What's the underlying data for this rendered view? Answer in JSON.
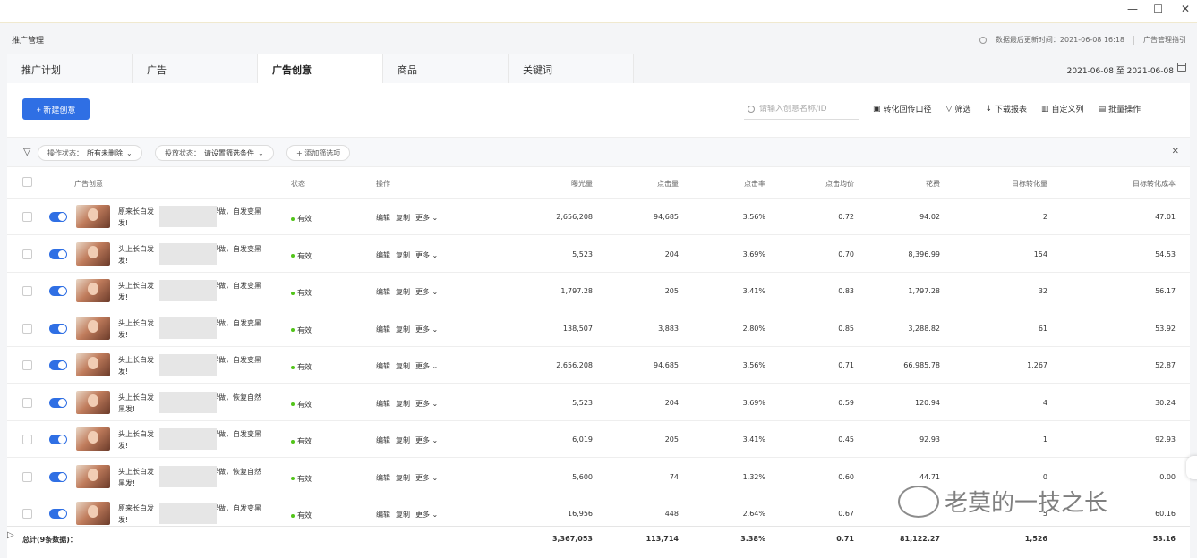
{
  "window": {
    "minimize": "—",
    "maximize": "☐",
    "close": "✕"
  },
  "header": {
    "title": "推广管理",
    "update_label": "数据最后更新时间：2021-06-08 16:18",
    "guide": "广告管理指引"
  },
  "tabs": [
    {
      "label": "推广计划",
      "active": false
    },
    {
      "label": "广告",
      "active": false
    },
    {
      "label": "广告创意",
      "active": true
    },
    {
      "label": "商品",
      "active": false
    },
    {
      "label": "关键词",
      "active": false
    }
  ],
  "date_range": "2021-06-08 至 2021-06-08",
  "toolbar": {
    "new_button": "+ 新建创意",
    "search_placeholder": "请输入创意名称/ID",
    "conversion": "转化回传口径",
    "filter": "筛选",
    "download": "下载报表",
    "custom_columns": "自定义列",
    "batch": "批量操作"
  },
  "filters": {
    "op_status_label": "操作状态：",
    "op_status_value": "所有未删除",
    "delivery_label": "投放状态：",
    "delivery_value": "请设置筛选条件",
    "add_filter": "+ 添加筛选项"
  },
  "columns": {
    "creative": "广告创意",
    "status": "状态",
    "ops": "操作",
    "impressions": "曝光量",
    "clicks": "点击量",
    "ctr": "点击率",
    "cpc": "点击均价",
    "cost": "花费",
    "conversions": "目标转化量",
    "cpa": "目标转化成本"
  },
  "op_labels": {
    "edit": "编辑",
    "copy": "复制",
    "more": "更多"
  },
  "rows": [
    {
      "line1": "原来长白发",
      "line1_tail": "这样做，自发变黑",
      "line2": "发!",
      "status": "有效",
      "impressions": "2,656,208",
      "clicks": "94,685",
      "ctr": "3.56%",
      "cpc": "0.72",
      "cost": "94.02",
      "conversions": "2",
      "cpa": "47.01"
    },
    {
      "line1": "头上长白发",
      "line1_tail": "这样做，自发变黑",
      "line2": "发!",
      "status": "有效",
      "impressions": "5,523",
      "clicks": "204",
      "ctr": "3.69%",
      "cpc": "0.70",
      "cost": "8,396.99",
      "conversions": "154",
      "cpa": "54.53"
    },
    {
      "line1": "头上长白发",
      "line1_tail": "这样做，自发变黑",
      "line2": "发!",
      "status": "有效",
      "impressions": "1,797.28",
      "clicks": "205",
      "ctr": "3.41%",
      "cpc": "0.83",
      "cost": "1,797.28",
      "conversions": "32",
      "cpa": "56.17"
    },
    {
      "line1": "头上长白发",
      "line1_tail": "这样做，自发变黑",
      "line2": "发!",
      "status": "有效",
      "impressions": "138,507",
      "clicks": "3,883",
      "ctr": "2.80%",
      "cpc": "0.85",
      "cost": "3,288.82",
      "conversions": "61",
      "cpa": "53.92"
    },
    {
      "line1": "头上长白发",
      "line1_tail": "这样做，自发变黑",
      "line2": "发!",
      "status": "有效",
      "impressions": "2,656,208",
      "clicks": "94,685",
      "ctr": "3.56%",
      "cpc": "0.71",
      "cost": "66,985.78",
      "conversions": "1,267",
      "cpa": "52.87"
    },
    {
      "line1": "头上长白发",
      "line1_tail": "这样做，恢复自然",
      "line2": "黑发!",
      "status": "有效",
      "impressions": "5,523",
      "clicks": "204",
      "ctr": "3.69%",
      "cpc": "0.59",
      "cost": "120.94",
      "conversions": "4",
      "cpa": "30.24"
    },
    {
      "line1": "头上长白发",
      "line1_tail": "这样做，自发变黑",
      "line2": "发!",
      "status": "有效",
      "impressions": "6,019",
      "clicks": "205",
      "ctr": "3.41%",
      "cpc": "0.45",
      "cost": "92.93",
      "conversions": "1",
      "cpa": "92.93"
    },
    {
      "line1": "头上长白发",
      "line1_tail": "这样做，恢复自然",
      "line2": "黑发!",
      "status": "有效",
      "impressions": "5,600",
      "clicks": "74",
      "ctr": "1.32%",
      "cpc": "0.60",
      "cost": "44.71",
      "conversions": "0",
      "cpa": "0.00"
    },
    {
      "line1": "原来长白发",
      "line1_tail": "这样做，自发变黑",
      "line2": "发!",
      "status": "有效",
      "impressions": "16,956",
      "clicks": "448",
      "ctr": "2.64%",
      "cpc": "0.67",
      "cost": "",
      "conversions": "5",
      "cpa": "60.16"
    }
  ],
  "totals": {
    "label": "总计(9条数据)：",
    "impressions": "3,367,053",
    "clicks": "113,714",
    "ctr": "3.38%",
    "cpc": "0.71",
    "cost": "81,122.27",
    "conversions": "1,526",
    "cpa": "53.16"
  },
  "watermark": "老莫的一技之长"
}
